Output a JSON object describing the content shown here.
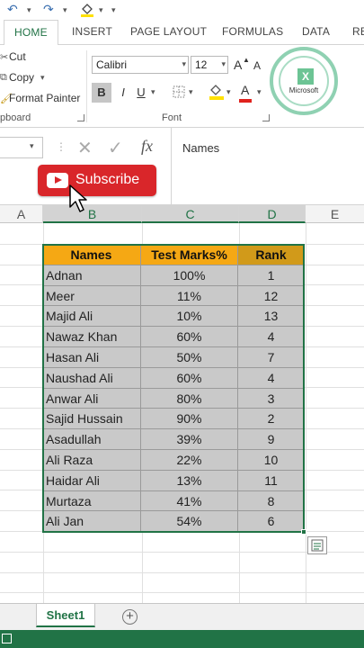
{
  "quick_access": {
    "undo": "↶",
    "redo": "↷",
    "paint": "🖌"
  },
  "tabs": [
    {
      "label": "HOME",
      "active": true
    },
    {
      "label": "INSERT"
    },
    {
      "label": "PAGE LAYOUT"
    },
    {
      "label": "FORMULAS"
    },
    {
      "label": "DATA"
    },
    {
      "label": "RE"
    }
  ],
  "clipboard": {
    "cut": "Cut",
    "copy": "Copy",
    "format_painter": "Format Painter",
    "group_label": "pboard"
  },
  "font": {
    "name": "Calibri",
    "size": "12",
    "grow": "A",
    "shrink": "A",
    "bold": "B",
    "italic": "I",
    "underline": "U",
    "font_color_letter": "A",
    "highlight_color": "#ffe100",
    "font_color": "#e0221d",
    "group_label": "Font"
  },
  "formula_bar": {
    "value": "Names",
    "fx": "fx",
    "cancel": "✕",
    "enter": "✓"
  },
  "subscribe": {
    "label": "Subscribe"
  },
  "columns": [
    "A",
    "B",
    "C",
    "D",
    "E"
  ],
  "table": {
    "headers": [
      "Names",
      "Test Marks%",
      "Rank"
    ],
    "rows": [
      [
        "Adnan",
        "100%",
        "1"
      ],
      [
        "Meer",
        "11%",
        "12"
      ],
      [
        "Majid Ali",
        "10%",
        "13"
      ],
      [
        "Nawaz Khan",
        "60%",
        "4"
      ],
      [
        "Hasan Ali",
        "50%",
        "7"
      ],
      [
        "Naushad Ali",
        "60%",
        "4"
      ],
      [
        "Anwar Ali",
        "80%",
        "3"
      ],
      [
        "Sajid Hussain",
        "90%",
        "2"
      ],
      [
        "Asadullah",
        "39%",
        "9"
      ],
      [
        "Ali Raza",
        "22%",
        "10"
      ],
      [
        "Haidar Ali",
        "13%",
        "11"
      ],
      [
        "Murtaza",
        "41%",
        "8"
      ],
      [
        "Ali Jan",
        "54%",
        "6"
      ]
    ]
  },
  "sheets": [
    {
      "label": "Sheet1",
      "active": true
    }
  ],
  "add_sheet": "+",
  "watermark": {
    "text": "Microsoft",
    "logo": "X"
  },
  "colors": {
    "accent": "#217346",
    "header_fill": "#f5a814",
    "rank_fill": "#d19a1a",
    "body_fill": "#c9c9c9",
    "subscribe": "#d9262a"
  }
}
